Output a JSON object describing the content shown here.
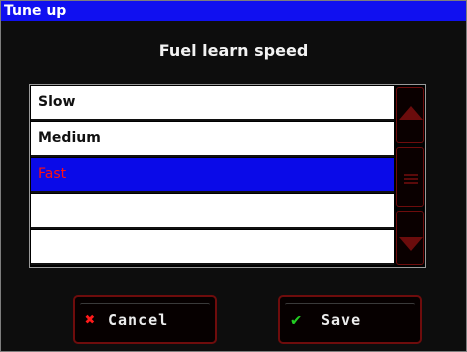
{
  "window": {
    "title": "Tune up"
  },
  "dialog": {
    "heading": "Fuel learn speed"
  },
  "options": [
    "Slow",
    "Medium",
    "Fast",
    "",
    ""
  ],
  "selected_option": "Fast",
  "buttons": {
    "cancel_label": "Cancel",
    "save_label": "Save"
  },
  "icons": {
    "cancel": "close-icon",
    "save": "checkmark-icon",
    "scroll_up": "triangle-up-icon",
    "scroll_down": "triangle-down-icon"
  },
  "colors": {
    "title_bar": "#1010f0",
    "selected_row": "#0a0ae8",
    "selected_text": "#ff1010",
    "accent_border": "#6e0c0c",
    "cancel_icon": "#ff1a1a",
    "save_icon": "#22cc22"
  }
}
